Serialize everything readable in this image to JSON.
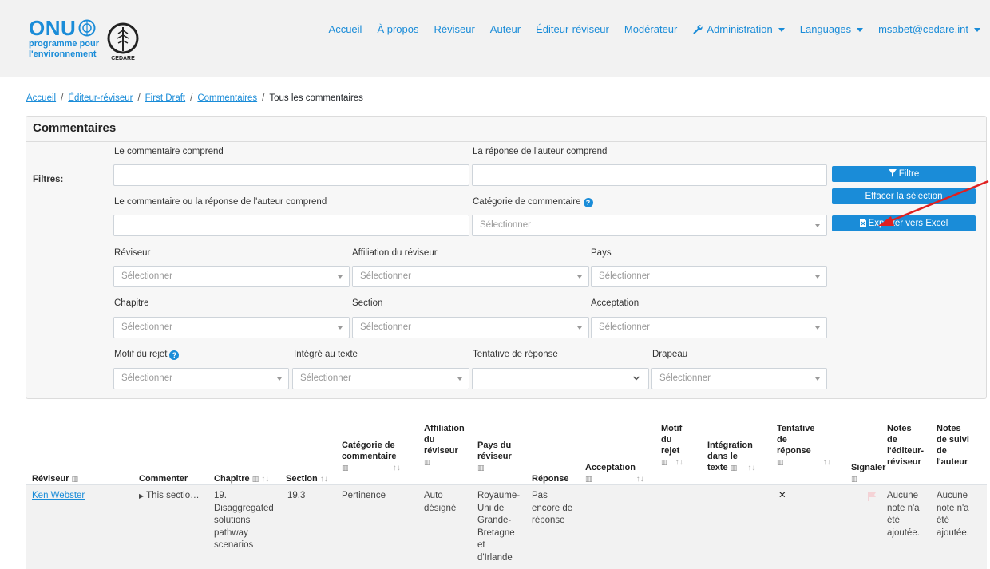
{
  "header": {
    "logo_unep_main": "ONU",
    "logo_unep_line1": "programme pour",
    "logo_unep_line2": "l'environnement",
    "logo_cedare_text": "CEDARE",
    "nav": {
      "accueil": "Accueil",
      "apropos": "À propos",
      "reviseur": "Réviseur",
      "auteur": "Auteur",
      "editeur_reviseur": "Éditeur-réviseur",
      "moderateur": "Modérateur",
      "administration": "Administration",
      "languages": "Languages",
      "user": "msabet@cedare.int"
    }
  },
  "breadcrumb": {
    "accueil": "Accueil",
    "editeur": "Éditeur-réviseur",
    "draft": "First Draft",
    "commentaires": "Commentaires",
    "current": "Tous les commentaires",
    "sep": "/"
  },
  "filters": {
    "card_title": "Commentaires",
    "filtres_label": "Filtres:",
    "comment_includes": "Le commentaire comprend",
    "author_response_includes": "La réponse de l'auteur comprend",
    "comment_or_response": "Le commentaire ou la réponse de l'auteur comprend",
    "comment_category": "Catégorie de commentaire",
    "reviewer": "Réviseur",
    "reviewer_affiliation": "Affiliation du réviseur",
    "country": "Pays",
    "chapter": "Chapitre",
    "section": "Section",
    "acceptance": "Acceptation",
    "rejection_reason": "Motif du rejet",
    "integrated": "Intégré au texte",
    "response_attempt": "Tentative de réponse",
    "flag": "Drapeau",
    "placeholder": "Sélectionner",
    "btn_filter": "Filtre",
    "btn_clear": "Effacer la sélection",
    "btn_export": "Exporter vers Excel"
  },
  "table": {
    "headers": {
      "reviewer": "Réviseur",
      "commenter": "Commenter",
      "chapter": "Chapitre",
      "section": "Section",
      "category_l1": "Catégorie de",
      "category_l2": "commentaire",
      "affil_l1": "Affiliation",
      "affil_l2": "du",
      "affil_l3": "réviseur",
      "country_l1": "Pays du",
      "country_l2": "réviseur",
      "response": "Réponse",
      "acceptance": "Acceptation",
      "motif_l1": "Motif",
      "motif_l2": "du",
      "motif_l3": "rejet",
      "integ_l1": "Intégration",
      "integ_l2": "dans le",
      "integ_l3": "texte",
      "tent_l1": "Tentative",
      "tent_l2": "de",
      "tent_l3": "réponse",
      "signal": "Signaler",
      "ednotes_l1": "Notes",
      "ednotes_l2": "de",
      "ednotes_l3": "l'éditeur-",
      "ednotes_l4": "réviseur",
      "authnotes_l1": "Notes",
      "authnotes_l2": "de suivi",
      "authnotes_l3": "de",
      "authnotes_l4": "l'auteur"
    },
    "row": {
      "reviewer": "Ken Webster",
      "comment": "This sectio…",
      "chapter_l1": "19.",
      "chapter_l2": "Disaggregated",
      "chapter_l3": "solutions",
      "chapter_l4": "pathway",
      "chapter_l5": "scenarios",
      "section": "19.3",
      "category": "Pertinence",
      "affil_l1": "Auto",
      "affil_l2": "désigné",
      "country_l1": "Royaume-",
      "country_l2": "Uni de",
      "country_l3": "Grande-",
      "country_l4": "Bretagne",
      "country_l5": "et",
      "country_l6": "d'Irlande",
      "response_l1": "Pas",
      "response_l2": "encore de",
      "response_l3": "réponse",
      "tentative": "✕",
      "ednotes_l1": "Aucune",
      "ednotes_l2": "note n'a",
      "ednotes_l3": "été",
      "ednotes_l4": "ajoutée.",
      "authnotes_l1": "Aucune",
      "authnotes_l2": "note n'a",
      "authnotes_l3": "été",
      "authnotes_l4": "ajoutée."
    }
  },
  "colors": {
    "accent": "#1a8cd8",
    "annotation_arrow": "#e02020"
  }
}
